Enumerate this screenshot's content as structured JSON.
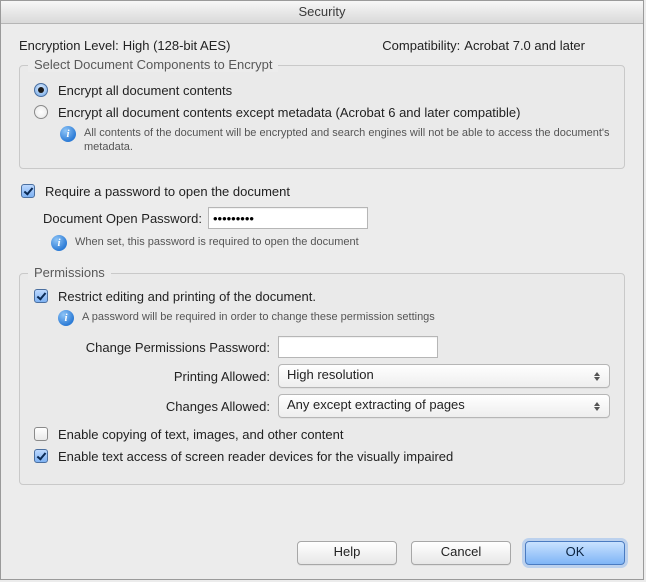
{
  "title": "Security",
  "encryption": {
    "label": "Encryption Level:",
    "value": "High (128-bit AES)"
  },
  "compatibility": {
    "label": "Compatibility:",
    "value": "Acrobat 7.0 and later"
  },
  "encrypt_group": {
    "title": "Select Document Components to Encrypt",
    "opt_all": "Encrypt all document contents",
    "opt_except_meta": "Encrypt all document contents except metadata (Acrobat 6 and later compatible)",
    "note": "All contents of the document will be encrypted and search engines will not be able to access the document's metadata."
  },
  "open_pw": {
    "require_label": "Require a password to open the document",
    "field_label": "Document Open Password:",
    "value": "•••••••••",
    "note": "When set, this password is required to open the document"
  },
  "permissions": {
    "group_title": "Permissions",
    "restrict_label": "Restrict editing and printing of the document.",
    "note": "A password will be required in order to change these permission settings",
    "change_pw_label": "Change Permissions Password:",
    "change_pw_value": "",
    "printing_label": "Printing Allowed:",
    "printing_value": "High resolution",
    "changes_label": "Changes Allowed:",
    "changes_value": "Any except extracting of pages",
    "copy_label": "Enable copying of text, images, and other content",
    "access_label": "Enable text access of screen reader devices for the visually impaired"
  },
  "buttons": {
    "help": "Help",
    "cancel": "Cancel",
    "ok": "OK"
  }
}
